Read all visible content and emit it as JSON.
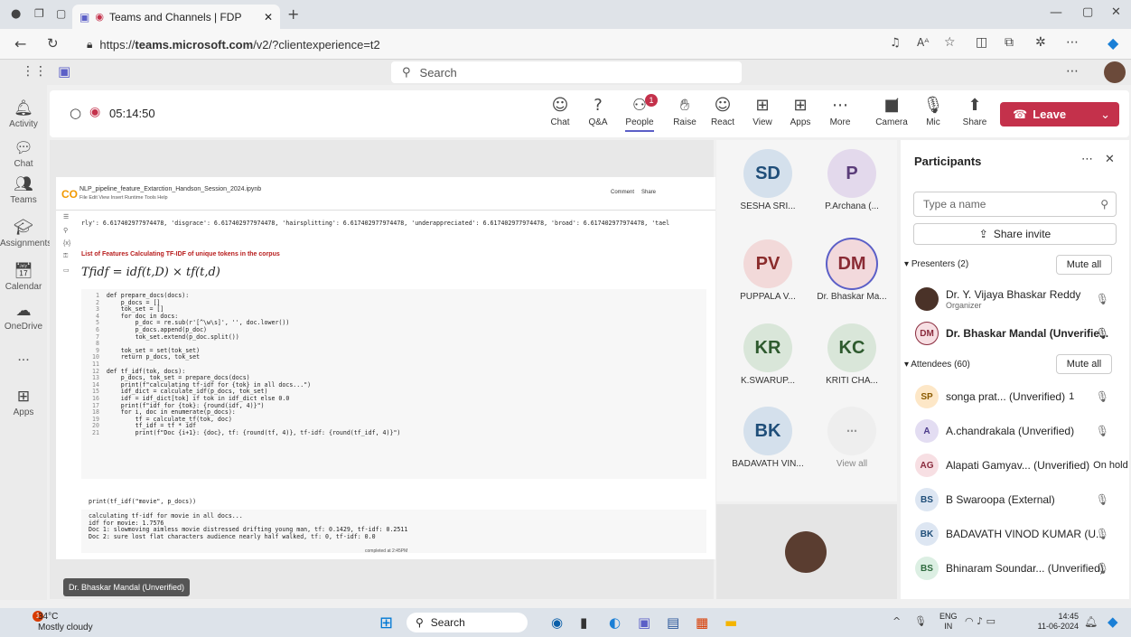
{
  "browser": {
    "tab_title": "Teams and Channels | FDP",
    "url_prefix": "https://",
    "url_host": "teams.microsoft.com",
    "url_path": "/v2/?clientexperience=t2"
  },
  "teams": {
    "search_placeholder": "Search",
    "rail": [
      "Activity",
      "Chat",
      "Teams",
      "Assignments",
      "Calendar",
      "OneDrive",
      "...",
      "Apps"
    ]
  },
  "meeting": {
    "timer": "05:14:50",
    "toolbar": [
      {
        "label": "Chat",
        "icon": "chat-icon"
      },
      {
        "label": "Q&A",
        "icon": "qa-icon"
      },
      {
        "label": "People",
        "icon": "people-icon"
      },
      {
        "label": "Raise",
        "icon": "raise-hand-icon"
      },
      {
        "label": "React",
        "icon": "react-icon"
      },
      {
        "label": "View",
        "icon": "view-icon"
      },
      {
        "label": "Apps",
        "icon": "apps-icon"
      },
      {
        "label": "More",
        "icon": "more-icon"
      },
      {
        "label": "Camera",
        "icon": "camera-off-icon"
      },
      {
        "label": "Mic",
        "icon": "mic-off-icon"
      },
      {
        "label": "Share",
        "icon": "share-icon"
      }
    ],
    "people_badge": "1",
    "leave_label": "Leave",
    "presenter_label": "Dr. Bhaskar Mandal (Unverified)"
  },
  "shared": {
    "notebook_title": "NLP_pipeline_feature_Extarction_Handson_Session_2024.ipynb",
    "menu": "File  Edit  View  Insert  Runtime  Tools  Help",
    "comment": "Comment",
    "share": "Share",
    "output_line": "rly': 6.617402977974478, 'disgrace': 6.617402977974478, 'hairsplitting': 6.617402977974478, 'underappreciated': 6.617402977974478, 'broad': 6.617402977974478, 'tael",
    "section_title": "List of Features Calculating TF-IDF of unique tokens in the corpus",
    "formula": "Tfidf = idf(t,D) × tf(t,d)",
    "code_lines": [
      "def prepare_docs(docs):",
      "    p_docs = []",
      "    tok_set = []",
      "    for doc in docs:",
      "        p_doc = re.sub(r'[^\\w\\s]', '', doc.lower())",
      "        p_docs.append(p_doc)",
      "        tok_set.extend(p_doc.split())",
      "",
      "    tok_set = set(tok_set)",
      "    return p_docs, tok_set",
      "",
      "def tf_idf(tok, docs):",
      "    p_docs, tok_set = prepare_docs(docs)",
      "    print(f\"calculating tf-idf for {tok} in all docs...\")",
      "    idf_dict = calculate_idf(p_docs, tok_set)",
      "    idf = idf_dict[tok] if tok in idf_dict else 0.0",
      "    print(f\"idf for {tok}: {round(idf, 4)}\")",
      "    for i, doc in enumerate(p_docs):",
      "        tf = calculate_tf(tok, doc)",
      "        tf_idf = tf * idf",
      "        print(f\"Doc {i+1}: {doc}, tf: {round(tf, 4)}, tf-idf: {round(tf_idf, 4)}\")"
    ],
    "call_line": "print(tf_idf(\"movie\", p_docs))",
    "output_lines": [
      "calculating tf-idf for movie in all docs...",
      "idf for movie: 1.7576",
      "Doc 1: slowmoving aimless movie distressed drifting young man, tf: 0.1429, tf-idf: 0.2511",
      "Doc 2: sure lost flat characters audience nearly half walked, tf: 0, tf-idf: 0.0"
    ],
    "status": "completed at 2:45PM"
  },
  "gallery": [
    {
      "initials": "SD",
      "name": "SESHA SRI...",
      "bg": "#d4e0ec",
      "fg": "#1f4e79"
    },
    {
      "initials": "P",
      "name": "P.Archana (...",
      "bg": "#e3d9ec",
      "fg": "#5b3d7a"
    },
    {
      "initials": "PV",
      "name": "PUPPALA V...",
      "bg": "#f2d9d9",
      "fg": "#8a2b2b"
    },
    {
      "initials": "DM",
      "name": "Dr. Bhaskar Ma...",
      "bg": "#f2d9dc",
      "fg": "#8a2b35"
    },
    {
      "initials": "KR",
      "name": "K.SWARUP...",
      "bg": "#d9e6d9",
      "fg": "#2e5a2e"
    },
    {
      "initials": "KC",
      "name": "KRITI CHA...",
      "bg": "#d9e6d9",
      "fg": "#2e5a2e"
    },
    {
      "initials": "BK",
      "name": "BADAVATH VIN...",
      "bg": "#d4e0ec",
      "fg": "#1f4e79"
    }
  ],
  "view_all": "View all",
  "panel": {
    "title": "Participants",
    "search_placeholder": "Type a name",
    "share_invite": "Share invite",
    "presenters_label": "Presenters (2)",
    "mute_all": "Mute all",
    "attendees_label": "Attendees (60)",
    "presenters": [
      {
        "name": "Dr. Y. Vijaya Bhaskar Reddy",
        "sub": "Organizer",
        "initials": ""
      },
      {
        "name": "Dr. Bhaskar Mandal (Unverifie...",
        "sub": "",
        "initials": "DM"
      }
    ],
    "attendees": [
      {
        "initials": "SP",
        "name": "songa prat... (Unverified)",
        "extra": "1",
        "bg": "#fde7c7",
        "fg": "#8a5a00"
      },
      {
        "initials": "A",
        "name": "A.chandrakala (Unverified)",
        "extra": "",
        "bg": "#e3ddf2",
        "fg": "#4b3a8a"
      },
      {
        "initials": "AG",
        "name": "Alapati Gamyav... (Unverified)",
        "extra": "On hold",
        "bg": "#f7dfe3",
        "fg": "#8a2b3d"
      },
      {
        "initials": "BS",
        "name": "B Swaroopa (External)",
        "extra": "",
        "bg": "#dde6f2",
        "fg": "#1f4e79"
      },
      {
        "initials": "BK",
        "name": "BADAVATH VINOD KUMAR (U...",
        "extra": "",
        "bg": "#dde6f2",
        "fg": "#1f4e79"
      },
      {
        "initials": "BS",
        "name": "Bhinaram Soundar... (Unverified)",
        "extra": "",
        "bg": "#dcefe3",
        "fg": "#2e6a3e"
      }
    ]
  },
  "taskbar": {
    "temp": "34°C",
    "weather": "Mostly cloudy",
    "weather_badge": "1",
    "search": "Search",
    "lang1": "ENG",
    "lang2": "IN",
    "time": "14:45",
    "date": "11-06-2024"
  }
}
